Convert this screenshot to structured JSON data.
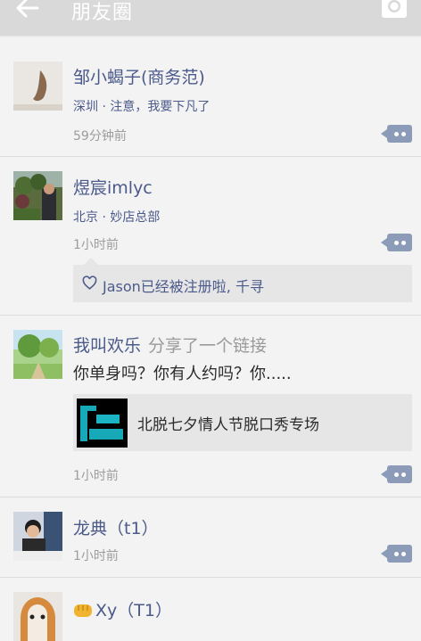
{
  "header": {
    "title": "朋友圈"
  },
  "posts": [
    {
      "name": "邹小蝎子(商务范)",
      "location": "深圳 · 注意，我要下凡了",
      "time": "59分钟前"
    },
    {
      "name": "煜宸imlyc",
      "location": "北京 · 妙店总部",
      "time": "1小时前",
      "likes": "Jason已经被注册啦, 千寻"
    },
    {
      "name": "我叫欢乐",
      "share_note": "分享了一个链接",
      "text": "你单身吗？你有人约吗？你.....",
      "link_title": "北脱七夕情人节脱口秀专场",
      "time": "1小时前"
    },
    {
      "name": "龙典（t1）",
      "time": "1小时前"
    },
    {
      "name": "Xy（T1）"
    }
  ],
  "icons": {
    "back": "arrow-left-icon",
    "camera": "camera-icon",
    "comment": "comment-ellipsis-icon",
    "like": "heart-outline-icon",
    "emoji": "fist-emoji-icon"
  },
  "colors": {
    "name": "#4b5a8b",
    "topbar": "#d9d9d9",
    "comment_button": "#8c9bb8"
  }
}
